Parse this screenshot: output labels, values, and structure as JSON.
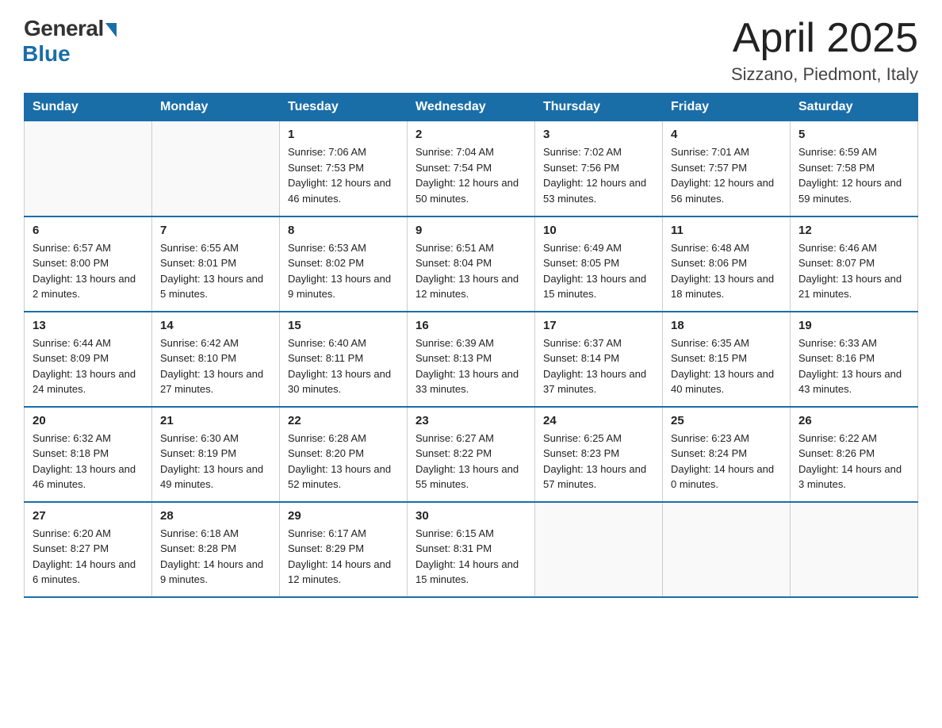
{
  "header": {
    "logo_general": "General",
    "logo_blue": "Blue",
    "month_title": "April 2025",
    "location": "Sizzano, Piedmont, Italy"
  },
  "weekdays": [
    "Sunday",
    "Monday",
    "Tuesday",
    "Wednesday",
    "Thursday",
    "Friday",
    "Saturday"
  ],
  "weeks": [
    [
      {
        "day": "",
        "sunrise": "",
        "sunset": "",
        "daylight": ""
      },
      {
        "day": "",
        "sunrise": "",
        "sunset": "",
        "daylight": ""
      },
      {
        "day": "1",
        "sunrise": "Sunrise: 7:06 AM",
        "sunset": "Sunset: 7:53 PM",
        "daylight": "Daylight: 12 hours and 46 minutes."
      },
      {
        "day": "2",
        "sunrise": "Sunrise: 7:04 AM",
        "sunset": "Sunset: 7:54 PM",
        "daylight": "Daylight: 12 hours and 50 minutes."
      },
      {
        "day": "3",
        "sunrise": "Sunrise: 7:02 AM",
        "sunset": "Sunset: 7:56 PM",
        "daylight": "Daylight: 12 hours and 53 minutes."
      },
      {
        "day": "4",
        "sunrise": "Sunrise: 7:01 AM",
        "sunset": "Sunset: 7:57 PM",
        "daylight": "Daylight: 12 hours and 56 minutes."
      },
      {
        "day": "5",
        "sunrise": "Sunrise: 6:59 AM",
        "sunset": "Sunset: 7:58 PM",
        "daylight": "Daylight: 12 hours and 59 minutes."
      }
    ],
    [
      {
        "day": "6",
        "sunrise": "Sunrise: 6:57 AM",
        "sunset": "Sunset: 8:00 PM",
        "daylight": "Daylight: 13 hours and 2 minutes."
      },
      {
        "day": "7",
        "sunrise": "Sunrise: 6:55 AM",
        "sunset": "Sunset: 8:01 PM",
        "daylight": "Daylight: 13 hours and 5 minutes."
      },
      {
        "day": "8",
        "sunrise": "Sunrise: 6:53 AM",
        "sunset": "Sunset: 8:02 PM",
        "daylight": "Daylight: 13 hours and 9 minutes."
      },
      {
        "day": "9",
        "sunrise": "Sunrise: 6:51 AM",
        "sunset": "Sunset: 8:04 PM",
        "daylight": "Daylight: 13 hours and 12 minutes."
      },
      {
        "day": "10",
        "sunrise": "Sunrise: 6:49 AM",
        "sunset": "Sunset: 8:05 PM",
        "daylight": "Daylight: 13 hours and 15 minutes."
      },
      {
        "day": "11",
        "sunrise": "Sunrise: 6:48 AM",
        "sunset": "Sunset: 8:06 PM",
        "daylight": "Daylight: 13 hours and 18 minutes."
      },
      {
        "day": "12",
        "sunrise": "Sunrise: 6:46 AM",
        "sunset": "Sunset: 8:07 PM",
        "daylight": "Daylight: 13 hours and 21 minutes."
      }
    ],
    [
      {
        "day": "13",
        "sunrise": "Sunrise: 6:44 AM",
        "sunset": "Sunset: 8:09 PM",
        "daylight": "Daylight: 13 hours and 24 minutes."
      },
      {
        "day": "14",
        "sunrise": "Sunrise: 6:42 AM",
        "sunset": "Sunset: 8:10 PM",
        "daylight": "Daylight: 13 hours and 27 minutes."
      },
      {
        "day": "15",
        "sunrise": "Sunrise: 6:40 AM",
        "sunset": "Sunset: 8:11 PM",
        "daylight": "Daylight: 13 hours and 30 minutes."
      },
      {
        "day": "16",
        "sunrise": "Sunrise: 6:39 AM",
        "sunset": "Sunset: 8:13 PM",
        "daylight": "Daylight: 13 hours and 33 minutes."
      },
      {
        "day": "17",
        "sunrise": "Sunrise: 6:37 AM",
        "sunset": "Sunset: 8:14 PM",
        "daylight": "Daylight: 13 hours and 37 minutes."
      },
      {
        "day": "18",
        "sunrise": "Sunrise: 6:35 AM",
        "sunset": "Sunset: 8:15 PM",
        "daylight": "Daylight: 13 hours and 40 minutes."
      },
      {
        "day": "19",
        "sunrise": "Sunrise: 6:33 AM",
        "sunset": "Sunset: 8:16 PM",
        "daylight": "Daylight: 13 hours and 43 minutes."
      }
    ],
    [
      {
        "day": "20",
        "sunrise": "Sunrise: 6:32 AM",
        "sunset": "Sunset: 8:18 PM",
        "daylight": "Daylight: 13 hours and 46 minutes."
      },
      {
        "day": "21",
        "sunrise": "Sunrise: 6:30 AM",
        "sunset": "Sunset: 8:19 PM",
        "daylight": "Daylight: 13 hours and 49 minutes."
      },
      {
        "day": "22",
        "sunrise": "Sunrise: 6:28 AM",
        "sunset": "Sunset: 8:20 PM",
        "daylight": "Daylight: 13 hours and 52 minutes."
      },
      {
        "day": "23",
        "sunrise": "Sunrise: 6:27 AM",
        "sunset": "Sunset: 8:22 PM",
        "daylight": "Daylight: 13 hours and 55 minutes."
      },
      {
        "day": "24",
        "sunrise": "Sunrise: 6:25 AM",
        "sunset": "Sunset: 8:23 PM",
        "daylight": "Daylight: 13 hours and 57 minutes."
      },
      {
        "day": "25",
        "sunrise": "Sunrise: 6:23 AM",
        "sunset": "Sunset: 8:24 PM",
        "daylight": "Daylight: 14 hours and 0 minutes."
      },
      {
        "day": "26",
        "sunrise": "Sunrise: 6:22 AM",
        "sunset": "Sunset: 8:26 PM",
        "daylight": "Daylight: 14 hours and 3 minutes."
      }
    ],
    [
      {
        "day": "27",
        "sunrise": "Sunrise: 6:20 AM",
        "sunset": "Sunset: 8:27 PM",
        "daylight": "Daylight: 14 hours and 6 minutes."
      },
      {
        "day": "28",
        "sunrise": "Sunrise: 6:18 AM",
        "sunset": "Sunset: 8:28 PM",
        "daylight": "Daylight: 14 hours and 9 minutes."
      },
      {
        "day": "29",
        "sunrise": "Sunrise: 6:17 AM",
        "sunset": "Sunset: 8:29 PM",
        "daylight": "Daylight: 14 hours and 12 minutes."
      },
      {
        "day": "30",
        "sunrise": "Sunrise: 6:15 AM",
        "sunset": "Sunset: 8:31 PM",
        "daylight": "Daylight: 14 hours and 15 minutes."
      },
      {
        "day": "",
        "sunrise": "",
        "sunset": "",
        "daylight": ""
      },
      {
        "day": "",
        "sunrise": "",
        "sunset": "",
        "daylight": ""
      },
      {
        "day": "",
        "sunrise": "",
        "sunset": "",
        "daylight": ""
      }
    ]
  ]
}
